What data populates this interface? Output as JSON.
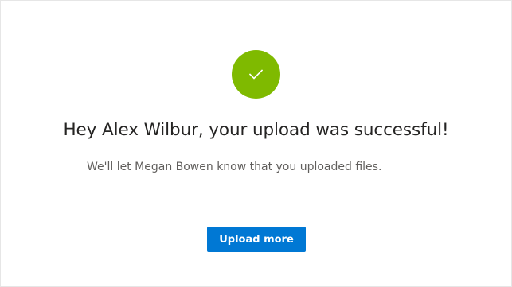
{
  "confirmation": {
    "icon": "checkmark-icon",
    "badge_color": "#7fba00",
    "headline": "Hey Alex Wilbur, your upload was successful!",
    "message": "We'll let Megan Bowen know that you uploaded files."
  },
  "actions": {
    "upload_more_label": "Upload more",
    "accent_color": "#0078d4"
  }
}
